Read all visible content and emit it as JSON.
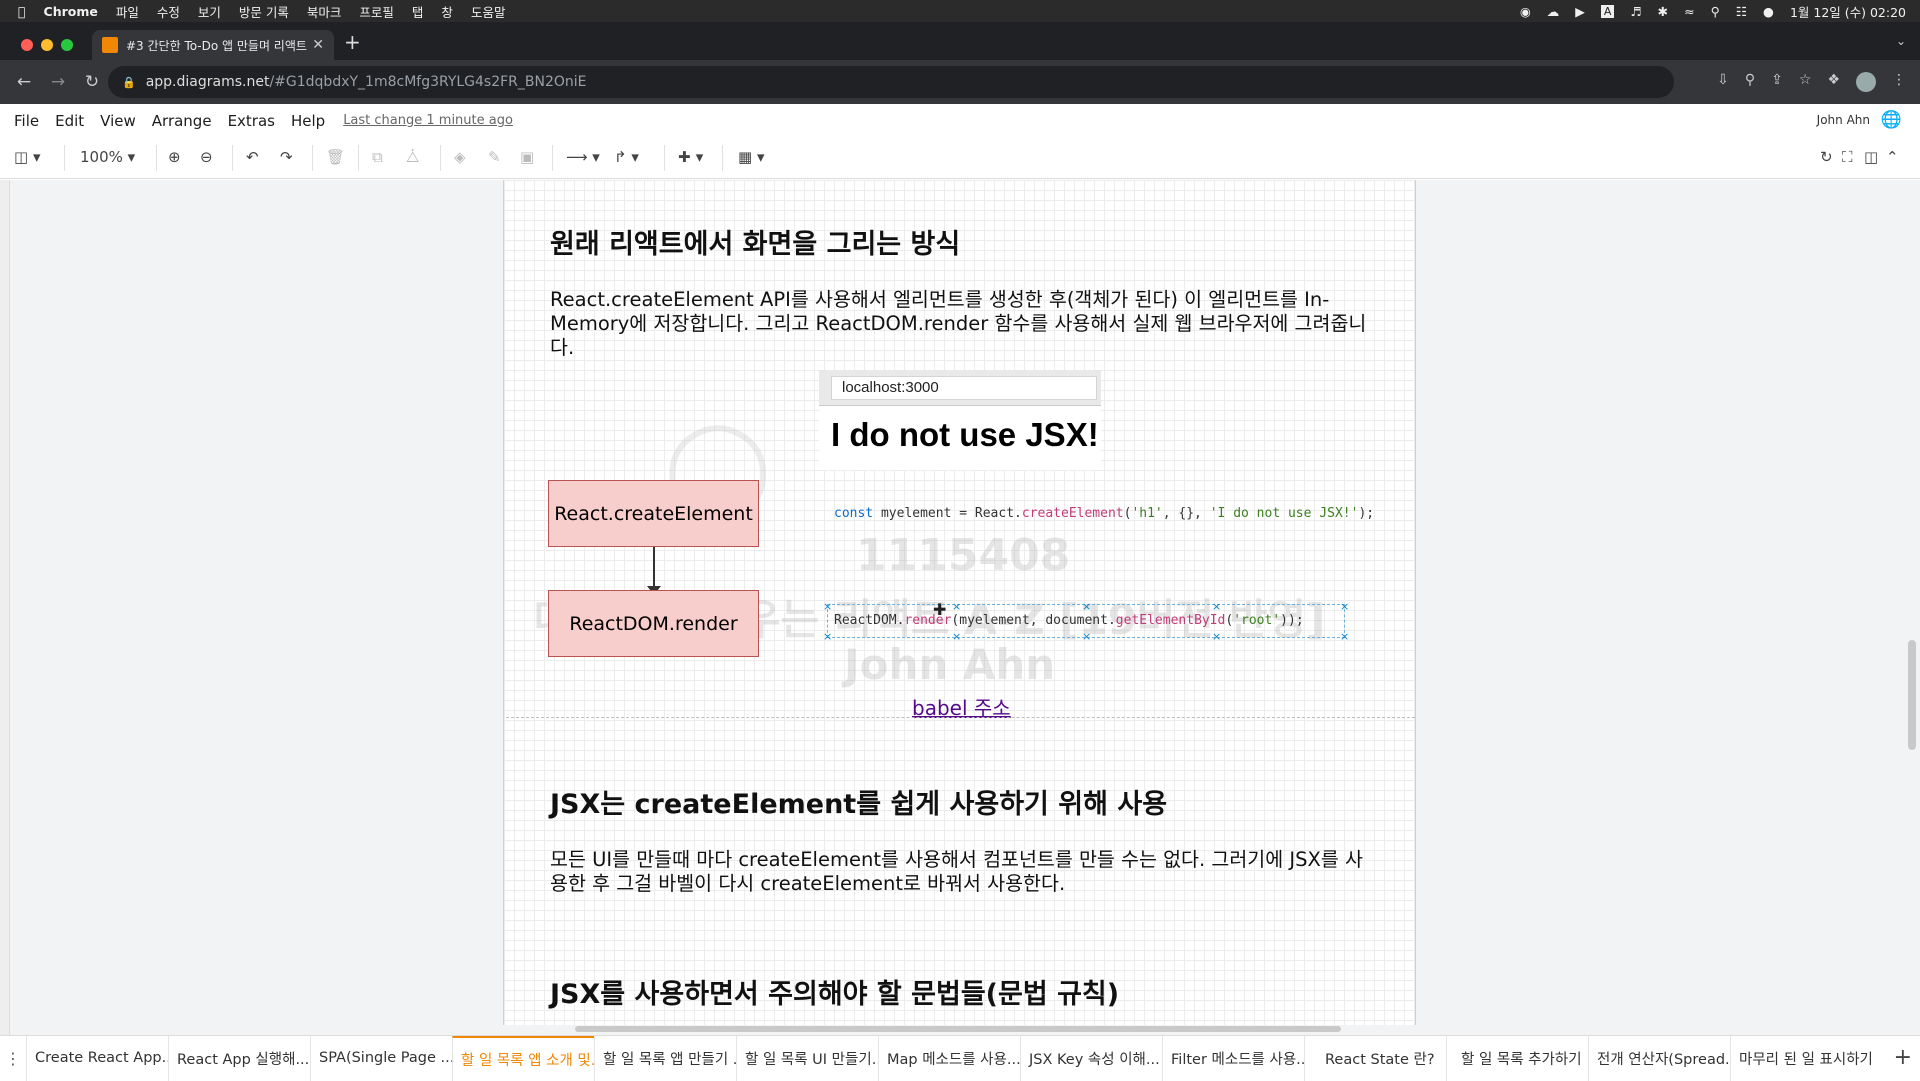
{
  "mac": {
    "app": "Chrome",
    "menu": [
      "파일",
      "수정",
      "보기",
      "방문 기록",
      "북마크",
      "프로필",
      "탭",
      "창",
      "도움말"
    ],
    "clock": "1월 12일 (수) 02:20",
    "input_badge": "A"
  },
  "browser": {
    "tab_title": "#3 간단한 To-Do 앱 만들며 리액트",
    "url_host": "app.diagrams.net",
    "url_rest": "/#G1dqbdxY_1m8cMfg3RYLG4s2FR_BN2OniE"
  },
  "menubar": {
    "items": [
      "File",
      "Edit",
      "View",
      "Arrange",
      "Extras",
      "Help"
    ],
    "last_change": "Last change 1 minute ago",
    "user": "John Ahn"
  },
  "toolbar": {
    "zoom": "100%"
  },
  "content": {
    "heading1": "원래 리액트에서 화면을 그리는 방식",
    "para1": "React.createElement  API를 사용해서 엘리먼트를 생성한 후(객체가 된다) 이 엘리먼트를 In-Memory에 저장합니다. 그리고 ReactDOM.render 함수를 사용해서 실제 웹 브라우저에 그려줍니다.",
    "browser_url": "localhost:3000",
    "browser_text": "I do not use JSX!",
    "box1": "React.createElement",
    "box2": "ReactDOM.render",
    "code1_kw": "const",
    "code1_a": " myelement = React.",
    "code1_fn": "createElement",
    "code1_b": "(",
    "code1_s1": "'h1'",
    "code1_c": ", {}, ",
    "code1_s2": "'I do not use JSX!'",
    "code1_d": ");",
    "code2_a": "ReactDOM.",
    "code2_fn": "render",
    "code2_b": "(myelement, document.",
    "code2_fn2": "getElementById",
    "code2_c": "(",
    "code2_s": "'root'",
    "code2_d": "));",
    "link": "babel 주소",
    "heading2": "JSX는 createElement를 쉽게 사용하기 위해 사용",
    "para2": "모든 UI를 만들때 마다 createElement를 사용해서 컴포넌트를 만들 수는 없다. 그러기에 JSX를 사용한 후 그걸 바벨이 다시 createElement로 바꿔서 사용한다.",
    "heading3": "JSX를 사용하면서 주의해야 할 문법들(문법 규칙)",
    "watermark_num": "1115408",
    "watermark_title": "따라하며 배우는 리액트 A-Z [19버전 반영]",
    "watermark_name": "John Ahn"
  },
  "pages": [
    "Create React App...",
    "React App 실행해...",
    "SPA(Single Page ...",
    "할 일 목록 앱 소개 및...",
    "할 일 목록 앱 만들기 ...",
    "할 일 목록 UI 만들기...",
    "Map 메소드를 사용...",
    "JSX Key 속성 이해...",
    "Filter 메소드를 사용...",
    "React State 란?",
    "할 일 목록 추가하기",
    "전개 연산자(Spread...",
    "마무리 된 일 표시하기"
  ],
  "active_page_index": 3
}
